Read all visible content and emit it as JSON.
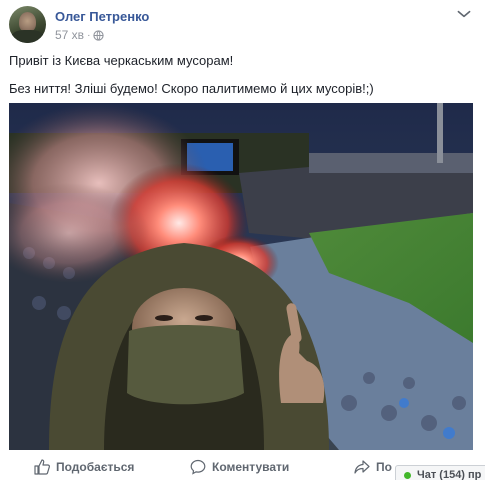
{
  "post": {
    "author": "Олег Петренко",
    "time": "57 хв",
    "separator": "·",
    "privacy_icon": "globe-icon",
    "more_icon": "more-options-icon",
    "lines": [
      "Привіт із Києва черкаським мусорам!",
      "Без ниття! Зліші будемо! Скоро палитимемо й цих мусорів!;)"
    ]
  },
  "photo": {
    "description_icon": "stadium-photo"
  },
  "actions": {
    "like": "Подобається",
    "comment": "Коментувати",
    "share": "По"
  },
  "chat": {
    "label": "Чат (154) пр"
  },
  "colors": {
    "author": "#385898",
    "meta": "#90949c",
    "action_text": "#606770",
    "online": "#42b72a"
  }
}
